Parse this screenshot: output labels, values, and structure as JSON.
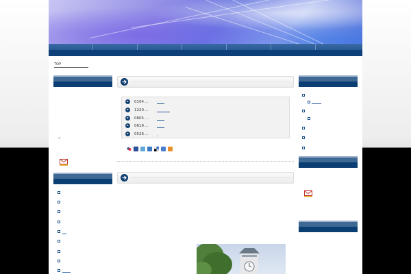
{
  "breadcrumb": {
    "label": "TOP"
  },
  "news": {
    "items": [
      {
        "date": "0104 ..."
      },
      {
        "date": "1220 ..."
      },
      {
        "date": "0805 ..."
      },
      {
        "date": "0619 ..."
      },
      {
        "date": "0526 ..."
      }
    ]
  },
  "share": {
    "icons": [
      "share-hatena-icon",
      "share-yahoo-icon",
      "share-livedoor-icon",
      "share-buzzurl-icon",
      "share-delicious-icon",
      "share-google-icon",
      "share-rss-icon"
    ]
  },
  "left_sidebar": {
    "small_mark": "→"
  },
  "colors": {
    "nav": "#0d3f78",
    "accent": "#1a4f86",
    "link": "#2a5b9b"
  }
}
